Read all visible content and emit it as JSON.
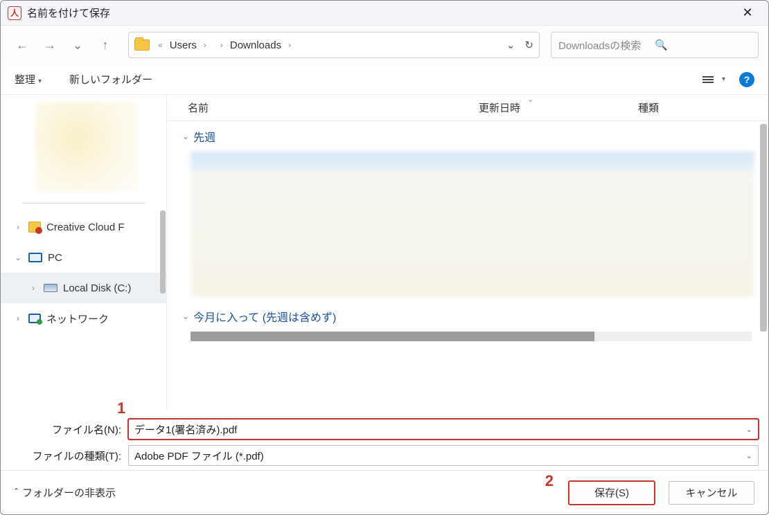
{
  "titlebar": {
    "title": "名前を付けて保存"
  },
  "nav": {
    "crumbs": {
      "c1": "Users",
      "c2": " ",
      "c3": "Downloads"
    },
    "search_placeholder": "Downloadsの検索"
  },
  "toolbar": {
    "organize": "整理",
    "new_folder": "新しいフォルダー"
  },
  "columns": {
    "name": "名前",
    "modified": "更新日時",
    "type": "種類"
  },
  "groups": {
    "last_week": "先週",
    "earlier_this_month": "今月に入って (先週は含めず)"
  },
  "sidebar": {
    "creative_cloud": "Creative Cloud F",
    "pc": "PC",
    "local_disk": "Local Disk (C:)",
    "network": "ネットワーク"
  },
  "fields": {
    "filename_label": "ファイル名(N):",
    "filename_value": "データ1(署名済み).pdf",
    "filetype_label": "ファイルの種類(T):",
    "filetype_value": "Adobe PDF ファイル (*.pdf)"
  },
  "footer": {
    "hide_folders": "フォルダーの非表示",
    "save": "保存(S)",
    "cancel": "キャンセル"
  },
  "annotations": {
    "one": "1",
    "two": "2"
  }
}
